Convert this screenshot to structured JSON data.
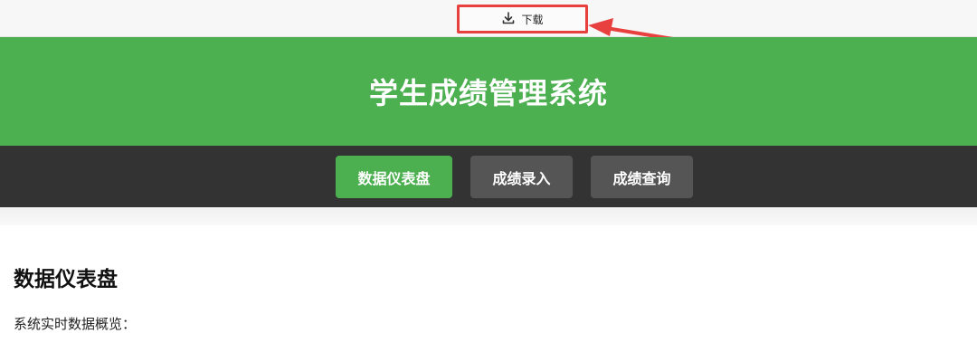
{
  "toolbar": {
    "download_label": "下载",
    "download_icon": "download-icon"
  },
  "annotation": {
    "color": "#e8403f"
  },
  "header": {
    "title": "学生成绩管理系统",
    "background": "#4caf50"
  },
  "nav": {
    "items": [
      {
        "label": "数据仪表盘",
        "active": true
      },
      {
        "label": "成绩录入",
        "active": false
      },
      {
        "label": "成绩查询",
        "active": false
      }
    ],
    "background": "#333333",
    "active_color": "#4caf50",
    "inactive_color": "#555555"
  },
  "main": {
    "section_title": "数据仪表盘",
    "subtitle": "系统实时数据概览："
  }
}
